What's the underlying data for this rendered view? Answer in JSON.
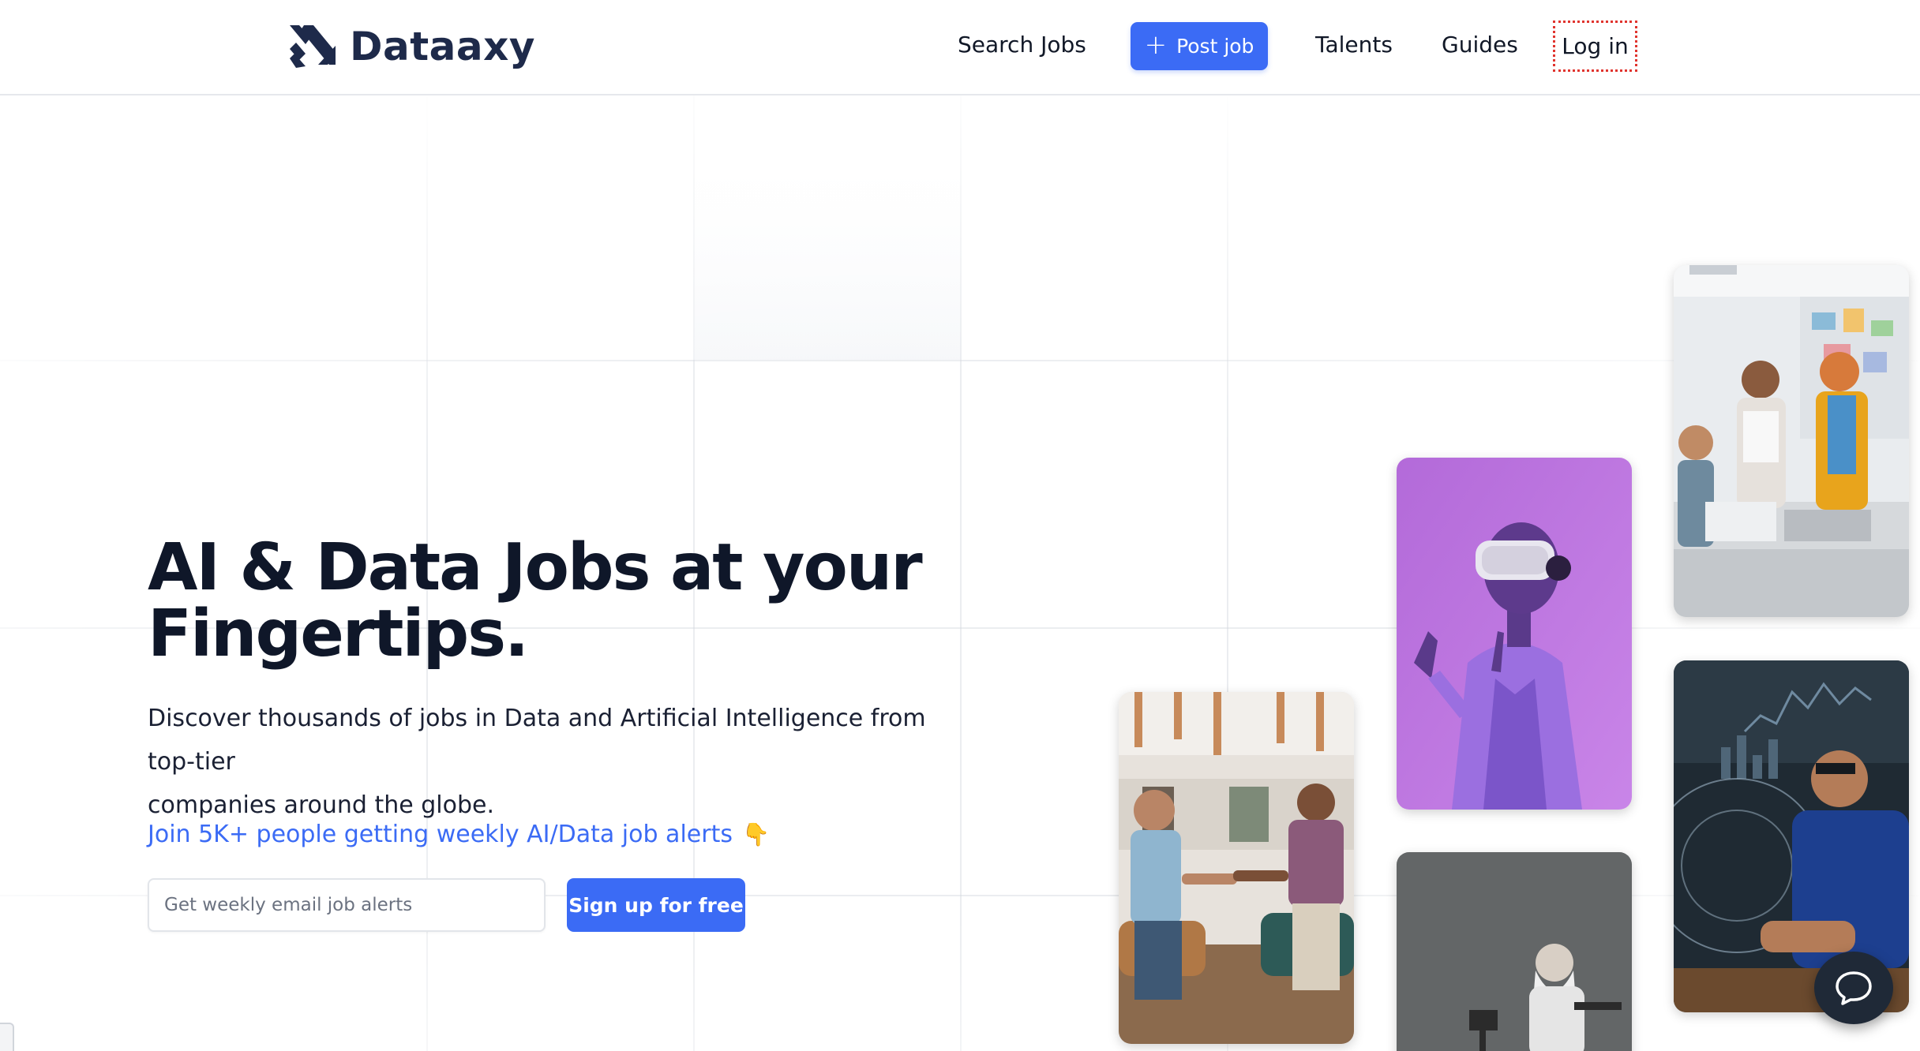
{
  "brand": {
    "name": "Dataaxy",
    "logo_icon": "dataaxy-logo-icon",
    "color": "#1e2a4a"
  },
  "nav": {
    "search_jobs": "Search Jobs",
    "post_job": "Post job",
    "post_job_icon": "plus-icon",
    "talents": "Talents",
    "guides": "Guides",
    "login": "Log in"
  },
  "hero": {
    "headline_line1": "AI & Data Jobs at your",
    "headline_line2": "Fingertips.",
    "subtitle_line1": "Discover thousands of jobs in Data and Artificial Intelligence from top-tier",
    "subtitle_line2": "companies around the globe.",
    "alerts_text": "Join 5K+ people getting weekly AI/Data job alerts",
    "alerts_emoji": "👇",
    "email_placeholder": "Get weekly email job alerts",
    "email_value": "",
    "signup_label": "Sign up for free"
  },
  "images": [
    {
      "name": "team-office-photo",
      "alt": "Team collaborating in office"
    },
    {
      "name": "vr-headset-photo",
      "alt": "Person wearing VR headset"
    },
    {
      "name": "handshake-meeting-photo",
      "alt": "Two people shaking hands"
    },
    {
      "name": "data-analyst-photo",
      "alt": "Man analyzing data on screen"
    },
    {
      "name": "photographer-photo",
      "alt": "Man with camera"
    }
  ],
  "chat": {
    "icon": "chat-bubble-icon"
  },
  "colors": {
    "accent": "#3b6bf5",
    "heading": "#0f1729",
    "link": "#3b6bf5",
    "login_outline": "#e0342e"
  }
}
